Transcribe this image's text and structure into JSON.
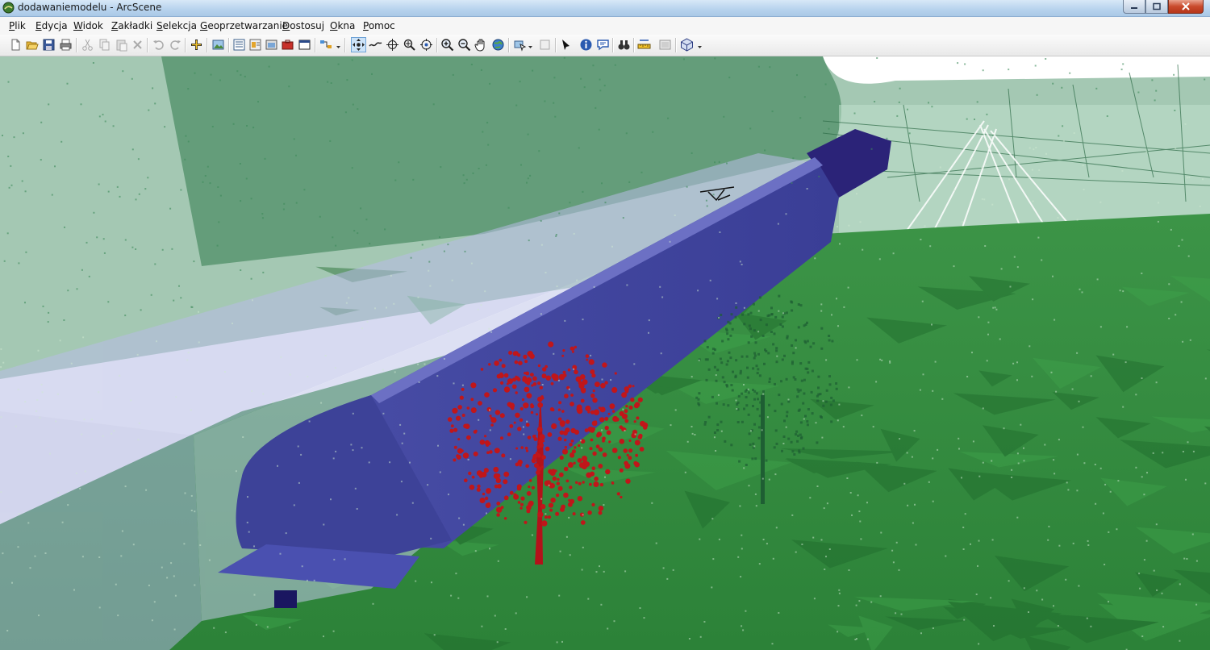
{
  "window": {
    "title": "dodawaniemodelu - ArcScene",
    "controls": [
      "minimize-button",
      "maximize-button",
      "close-button"
    ]
  },
  "menu": {
    "items": [
      "Plik",
      "Edycja",
      "Widok",
      "Zakładki",
      "Selekcja",
      "Geoprzetwarzanie",
      "Dostosuj",
      "Okna",
      "Pomoc"
    ]
  },
  "toolbar": {
    "tools": [
      "new-icon",
      "open-icon",
      "save-icon",
      "print-icon",
      "cut-icon",
      "copy-icon",
      "paste-icon",
      "delete-icon",
      "undo-icon",
      "redo-icon",
      "add-data-icon",
      "add-layer-icon",
      "scene-properties-icon",
      "table-of-contents-icon",
      "catalog-icon",
      "toolbox-icon",
      "python-window-icon",
      "model-builder-icon",
      "navigate-icon",
      "fly-icon",
      "center-target-icon",
      "zoom-to-target-icon",
      "set-observer-icon",
      "zoom-in-icon",
      "zoom-out-icon",
      "pan-icon",
      "full-extent-icon",
      "select-features-icon",
      "clear-selection-icon",
      "select-elements-icon",
      "identify-icon",
      "html-popup-icon",
      "find-icon",
      "measure-icon",
      "animation-icon",
      "3d-effects-icon"
    ],
    "active_tool": "navigate-icon"
  },
  "scene": {
    "colors": {
      "terrain": "#2f8a3e",
      "terrain_dark": "#1f6a2c",
      "point_cloud": "#3d8a5a",
      "train_model": "#3b3f9a",
      "train_ghost": "#a9b0dc",
      "tree_highlight": "#c0161a",
      "sky": "#ffffff"
    }
  }
}
